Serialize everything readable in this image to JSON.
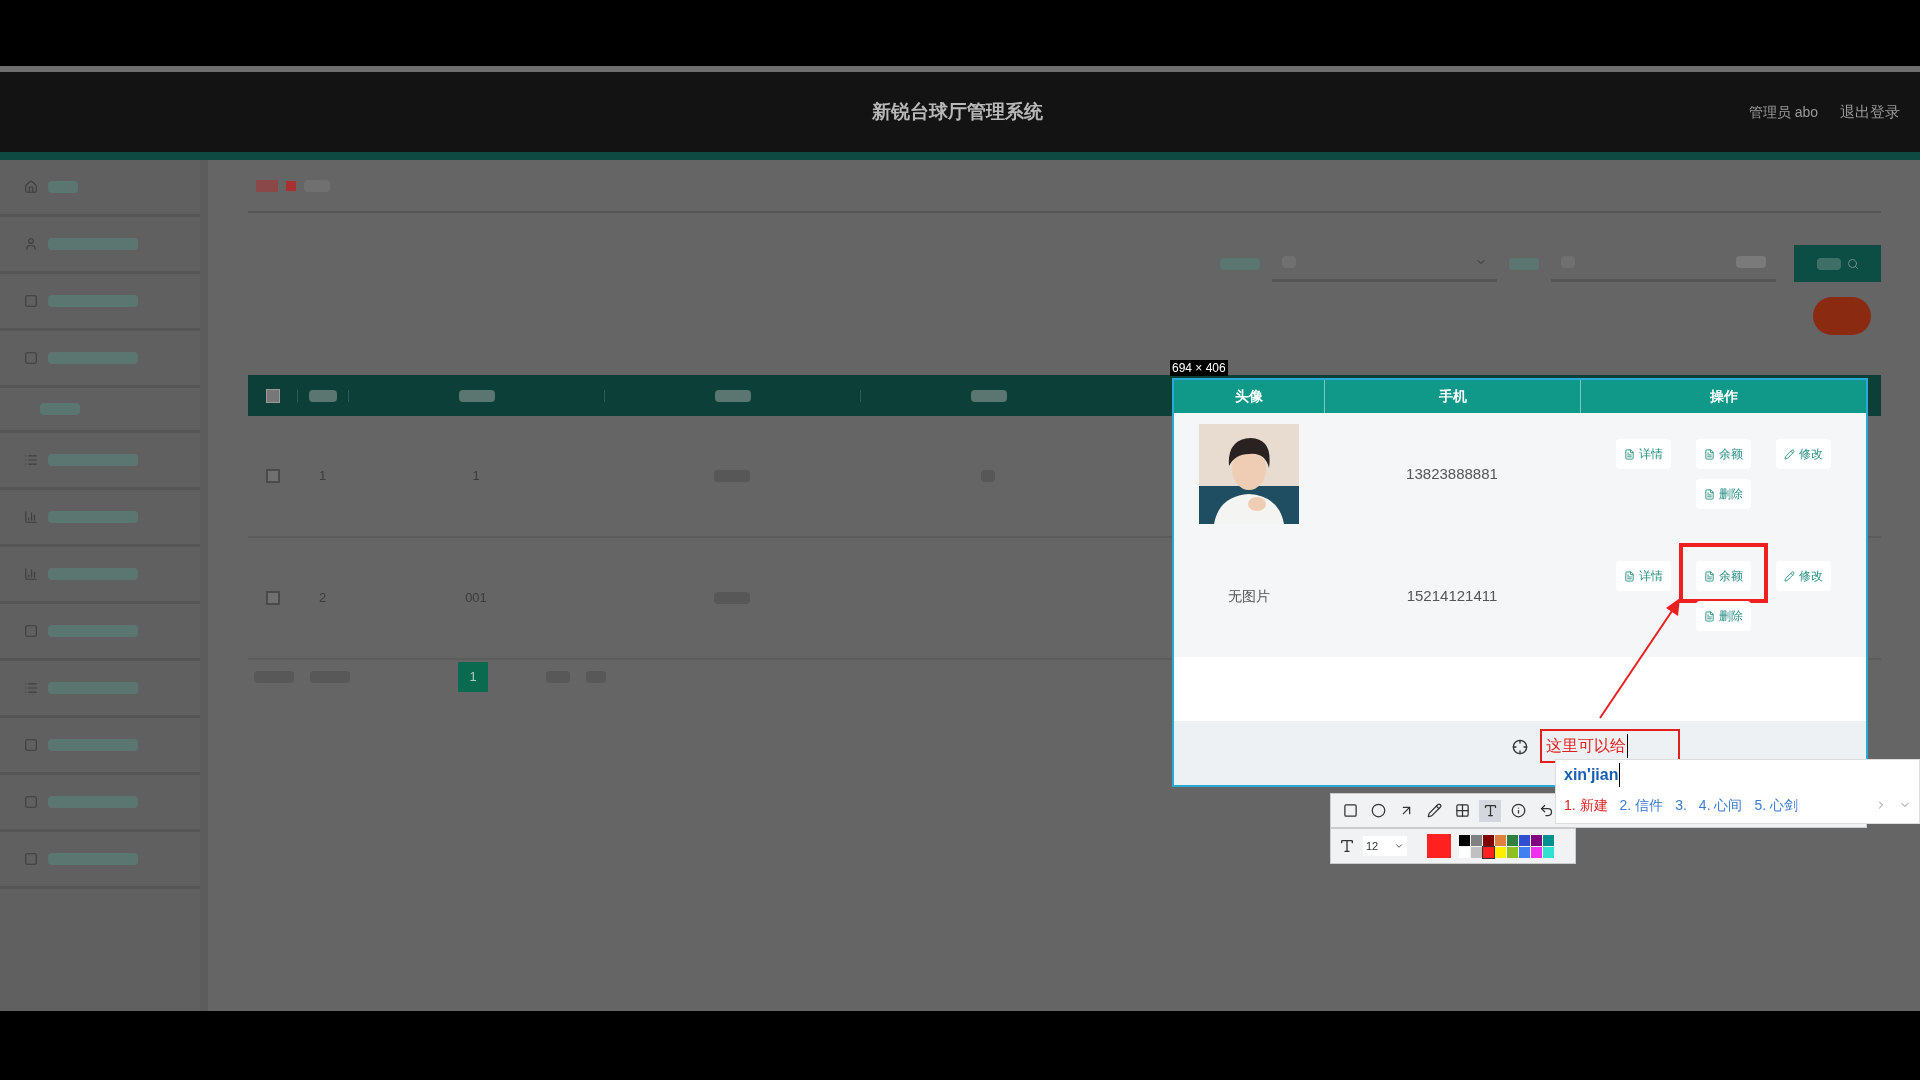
{
  "header": {
    "title": "新锐台球厅管理系统",
    "user": "管理员 abo",
    "logout": "退出登录"
  },
  "table": {
    "all_checked": false,
    "rows": [
      {
        "checked": false,
        "index": "1",
        "column_3": "1"
      },
      {
        "checked": false,
        "index": "2",
        "column_3": "001"
      }
    ]
  },
  "pagination": {
    "pages": [
      {
        "label": "1",
        "selected": true
      }
    ]
  },
  "capture": {
    "size": "694 × 406",
    "columns": [
      "头像",
      "手机",
      "操作"
    ],
    "rows": [
      {
        "avatar": {
          "kind": "picture"
        },
        "phone": "13823888881",
        "actions": [
          {
            "kind": "doc",
            "label": "详情",
            "boxed": false
          },
          {
            "kind": "doc",
            "label": "余额",
            "boxed": false
          },
          {
            "kind": "pencil",
            "label": "修改",
            "boxed": false
          },
          {
            "kind": "doc",
            "label": "删除",
            "boxed": false
          }
        ]
      },
      {
        "avatar": {
          "kind": "text",
          "text": "无图片"
        },
        "phone": "15214121411",
        "actions": [
          {
            "kind": "doc",
            "label": "详情",
            "boxed": false
          },
          {
            "kind": "doc",
            "label": "余额",
            "boxed": true
          },
          {
            "kind": "pencil",
            "label": "修改",
            "boxed": false
          },
          {
            "kind": "doc",
            "label": "删除",
            "boxed": false
          }
        ]
      }
    ],
    "annotation": {
      "text": "这里可以给"
    },
    "ime": {
      "input": "xin'jian",
      "candidates": [
        {
          "label": "1. 新建",
          "selected": true
        },
        {
          "label": "2. 信件",
          "selected": false
        },
        {
          "label": "3.",
          "selected": false
        },
        {
          "label": "4. 心间",
          "selected": false
        },
        {
          "label": "5. 心剑",
          "selected": false
        }
      ]
    },
    "toolbar": {
      "tools": [
        {
          "kind": "rect",
          "selected": false
        },
        {
          "kind": "circle",
          "selected": false
        },
        {
          "kind": "arrow",
          "selected": false
        },
        {
          "kind": "pencil",
          "selected": false
        },
        {
          "kind": "mosaic",
          "selected": false
        },
        {
          "kind": "text",
          "selected": true
        },
        {
          "kind": "number",
          "selected": false
        },
        {
          "kind": "undo",
          "selected": false
        }
      ],
      "font_size": "12",
      "palette": [
        {
          "color": "#000000",
          "selected": false
        },
        {
          "color": "#808080",
          "selected": false
        },
        {
          "color": "#800000",
          "selected": false
        },
        {
          "color": "#e08040",
          "selected": false
        },
        {
          "color": "#308040",
          "selected": false
        },
        {
          "color": "#3050d0",
          "selected": false
        },
        {
          "color": "#800080",
          "selected": false
        },
        {
          "color": "#009090",
          "selected": false
        },
        {
          "color": "#ffffff",
          "selected": false
        },
        {
          "color": "#c0c0c0",
          "selected": false
        },
        {
          "color": "#ff2020",
          "selected": true
        },
        {
          "color": "#ffee00",
          "selected": false
        },
        {
          "color": "#90c020",
          "selected": false
        },
        {
          "color": "#4080f0",
          "selected": false
        },
        {
          "color": "#f030f0",
          "selected": false
        },
        {
          "color": "#30e0d0",
          "selected": false
        }
      ]
    }
  }
}
